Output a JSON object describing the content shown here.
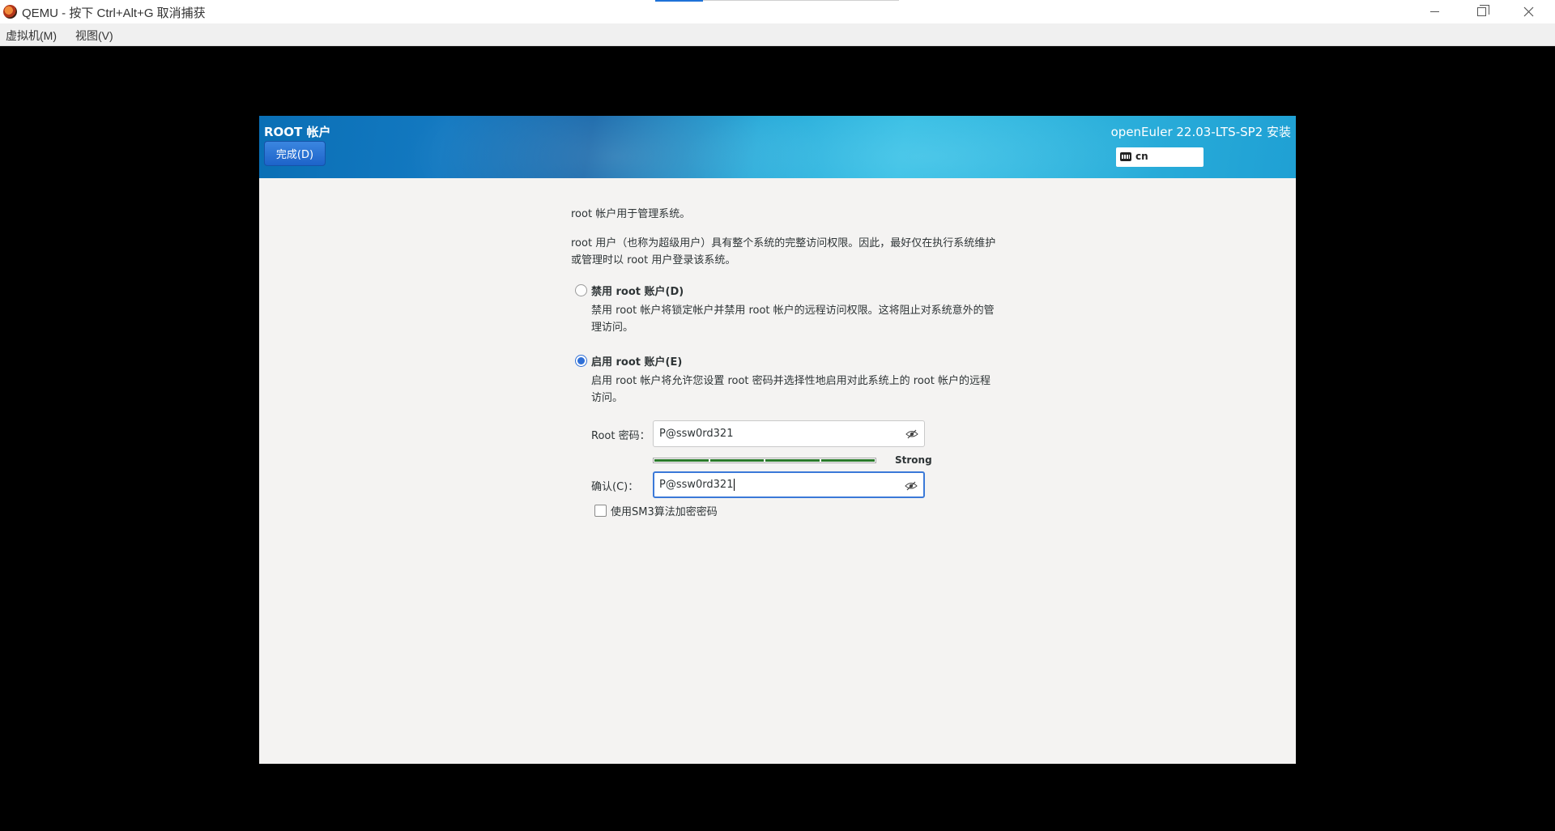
{
  "window": {
    "title": "QEMU - 按下 Ctrl+Alt+G 取消捕获",
    "menu": [
      "虚拟机(M)",
      "视图(V)"
    ]
  },
  "installer": {
    "spoke_title": "ROOT 帐户",
    "done_label": "完成(D)",
    "product_title": "openEuler 22.03-LTS-SP2 安装",
    "keyboard_layout": "cn",
    "intro": "root 帐户用于管理系统。",
    "description": "root 用户（也称为超级用户）具有整个系统的完整访问权限。因此，最好仅在执行系统维护或管理时以 root 用户登录该系统。",
    "options": [
      {
        "label": "禁用 root 账户(D)",
        "description": "禁用 root 帐户将锁定帐户并禁用 root 帐户的远程访问权限。这将阻止对系统意外的管理访问。",
        "selected": false
      },
      {
        "label": "启用 root 账户(E)",
        "description": "启用 root 帐户将允许您设置 root 密码并选择性地启用对此系统上的 root 帐户的远程访问。",
        "selected": true
      }
    ],
    "password_label": "Root 密码：",
    "password_value": "P@ssw0rd321",
    "strength_label": "Strong",
    "strength_level": 1.0,
    "confirm_label": "确认(C)：",
    "confirm_value": "P@ssw0rd321",
    "sm3_label": "使用SM3算法加密密码",
    "sm3_checked": false
  },
  "colors": {
    "accent": "#2f6fd6",
    "strength_bar": "#2a7a2a",
    "done_button": "#1d63c9"
  }
}
